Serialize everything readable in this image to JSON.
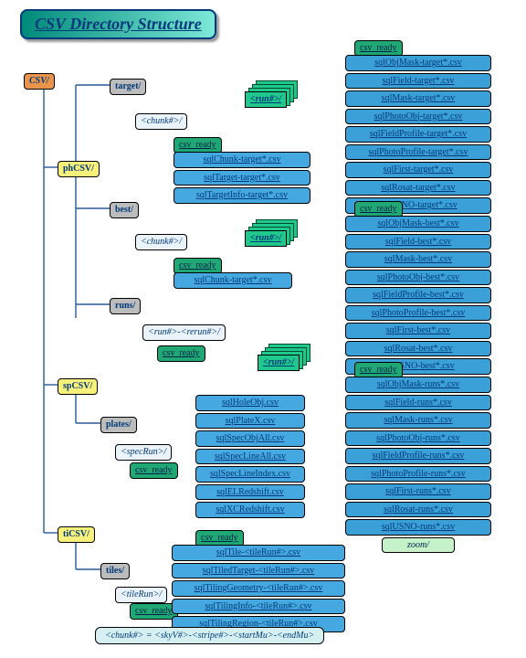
{
  "title": "CSV Directory Structure",
  "root": {
    "label": "CSV/"
  },
  "cats": {
    "ph": "phCSV/",
    "sp": "spCSV/",
    "ti": "tiCSV/"
  },
  "dirs": {
    "target": "target/",
    "best": "best/",
    "runs": "runs/",
    "plates": "plates/",
    "tiles": "tiles/"
  },
  "subs": {
    "chunk": "<chunk#>/",
    "run": "<run#>/",
    "rerun": "<run#>-<rerun#>/",
    "specrun": "<specRun>/",
    "tilerun": "<tileRun>/"
  },
  "ready": "csv_ready",
  "zoom": "zoom/",
  "target_files": [
    "sqlChunk-target*.csv",
    "sqlTarget-target*.csv",
    "sqlTargetInfo-target*.csv"
  ],
  "target_run_files": [
    "sqlObjMask-target*.csv",
    "sqlField-target*.csv",
    "sqlMask-target*.csv",
    "sqlPhotoObj-target*.csv",
    "sqlFieldProfile-target*.csv",
    "sqlPhotoProfile-target*.csv",
    "sqlFirst-target*.csv",
    "sqlRosat-target*.csv",
    "sqlUSNO-target*.csv"
  ],
  "best_files": [
    "sqlChunk-target*.csv"
  ],
  "best_run_files": [
    "sqlObjMask-best*.csv",
    "sqlField-best*.csv",
    "sqlMask-best*.csv",
    "sqlPhotoObj-best*.csv",
    "sqlFieldProfile-best*.csv",
    "sqlPhotoProfile-best*.csv",
    "sqlFirst-best*.csv",
    "sqlRosat-best*.csv",
    "sqlUSNO-best*.csv"
  ],
  "runs_run_files": [
    "sqlObjMask-runs*.csv",
    "sqlField-runs*.csv",
    "sqlMask-runs*.csv",
    "sqlPhotoObj-runs*.csv",
    "sqlFieldProfile-runs*.csv",
    "sqlPhotoProfile-runs*.csv",
    "sqlFirst-runs*.csv",
    "sqlRosat-runs*.csv",
    "sqlUSNO-runs*.csv"
  ],
  "plates_files": [
    "sqlHoleObj.csv",
    "sqlPlateX.csv",
    "sqlSpecObjAll.csv",
    "sqlSpecLineAll.csv",
    "sqlSpecLineIndex.csv",
    "sqlELRedshift.csv",
    "sqlXCRedshift.csv"
  ],
  "tiles_files": [
    "sqlTile-<tileRun#>.csv",
    "sqlTiledTarget-<tileRun#>.csv",
    "sqlTilingGeometry-<tileRun#>.csv",
    "sqlTilingInfo-<tileRun#>.csv",
    "sqlTilingRegion-<tileRun#>.csv"
  ],
  "footnote": "<chunk#>  =  <skyV#>-<stripe#>-<startMu>-<endMu>"
}
